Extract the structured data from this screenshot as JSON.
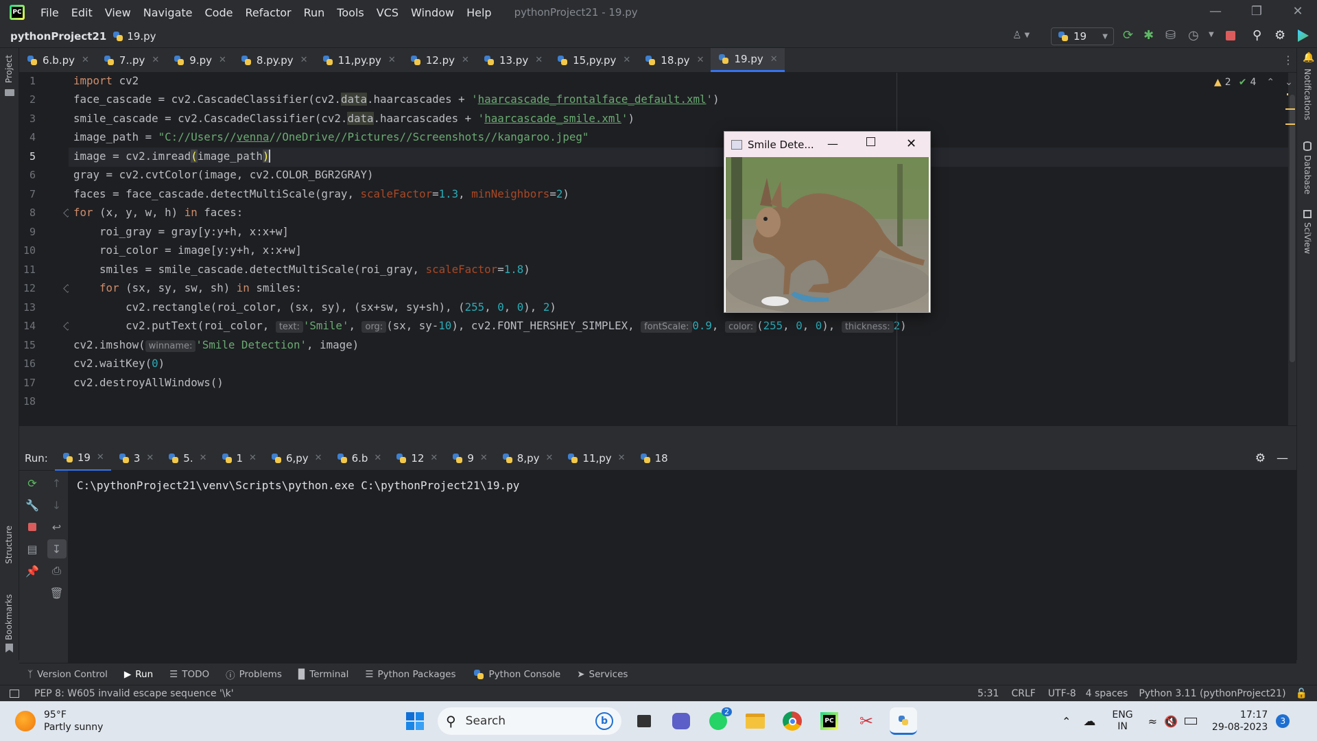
{
  "app": {
    "menu": [
      "File",
      "Edit",
      "View",
      "Navigate",
      "Code",
      "Refactor",
      "Run",
      "Tools",
      "VCS",
      "Window",
      "Help"
    ],
    "window_title": "pythonProject21 - 19.py"
  },
  "nav": {
    "project": "pythonProject21",
    "file": "19.py",
    "run_config": "19"
  },
  "tabs": [
    "6.b.py",
    "7..py",
    "9.py",
    "8.py.py",
    "11,py.py",
    "12.py",
    "13.py",
    "15,py.py",
    "18.py",
    "19.py"
  ],
  "active_tab": "19.py",
  "inspections": {
    "warnings": "2",
    "checks": "4"
  },
  "side_left": {
    "project": "Project",
    "structure": "Structure",
    "bookmarks": "Bookmarks"
  },
  "side_right": {
    "notifications": "Notifications",
    "database": "Database",
    "sciview": "SciView"
  },
  "code": {
    "lines": [
      "1",
      "2",
      "3",
      "4",
      "5",
      "6",
      "7",
      "8",
      "9",
      "10",
      "11",
      "12",
      "13",
      "14",
      "15",
      "16",
      "17",
      "18"
    ],
    "l1a": "import",
    "l1b": " cv2",
    "l2a": "face_cascade = cv2.CascadeClassifier(cv2.",
    "l2b": "data",
    "l2c": ".haarcascades + ",
    "l2d": "'",
    "l2e": "haarcascade_frontalface_default.xml",
    "l2f": "'",
    "l2g": ")",
    "l3a": "smile_cascade = cv2.CascadeClassifier(cv2.",
    "l3b": "data",
    "l3c": ".haarcascades + ",
    "l3d": "'",
    "l3e": "haarcascade_smile.xml",
    "l3f": "'",
    "l3g": ")",
    "l4a": "image_path = ",
    "l4b": "\"C://Users//",
    "l4c": "venna",
    "l4d": "//OneDrive//Pictures//Screenshots//kangaroo.jpeg\"",
    "l5a": "image = cv2.imread",
    "l5b": "(",
    "l5c": "image_path",
    "l5d": ")",
    "l6": "gray = cv2.cvtColor(image, cv2.COLOR_BGR2GRAY)",
    "l7a": "faces = face_cascade.detectMultiScale(gray, ",
    "l7b": "scaleFactor",
    "l7c": "=",
    "l7d": "1.3",
    "l7e": ", ",
    "l7f": "minNeighbors",
    "l7g": "=",
    "l7h": "2",
    "l7i": ")",
    "l8a": "for",
    "l8b": " (x, y, w, h) ",
    "l8c": "in",
    "l8d": " faces:",
    "l9": "    roi_gray = gray[y:y+h, x:x+w]",
    "l10": "    roi_color = image[y:y+h, x:x+w]",
    "l11a": "    smiles = smile_cascade.detectMultiScale(roi_gray, ",
    "l11b": "scaleFactor",
    "l11c": "=",
    "l11d": "1.8",
    "l11e": ")",
    "l12a": "    ",
    "l12b": "for",
    "l12c": " (sx, sy, sw, sh) ",
    "l12d": "in",
    "l12e": " smiles:",
    "l13a": "        cv2.rectangle(roi_color, (sx, sy), (sx+sw, sy+sh), (",
    "l13b": "255",
    "l13c": ", ",
    "l13d": "0",
    "l13e": ", ",
    "l13f": "0",
    "l13g": "), ",
    "l13h": "2",
    "l13i": ")",
    "l14a": "        cv2.putText(roi_color, ",
    "l14h1": "text:",
    "l14b": "'Smile'",
    "l14c": ", ",
    "l14h2": "org:",
    "l14d": "(sx, sy-",
    "l14e": "10",
    "l14f": "), cv2.FONT_HERSHEY_SIMPLEX, ",
    "l14h3": "fontScale:",
    "l14g": "0.9",
    "l14i": ", ",
    "l14h4": "color:",
    "l14j": "(",
    "l14k": "255",
    "l14l": ", ",
    "l14m": "0",
    "l14n": ", ",
    "l14o": "0",
    "l14p": "), ",
    "l14h5": "thickness:",
    "l14q": "2",
    "l14r": ")",
    "l15a": "cv2.imshow(",
    "l15h": "winname:",
    "l15b": "'Smile Detection'",
    "l15c": ", image)",
    "l16a": "cv2.waitKey(",
    "l16b": "0",
    "l16c": ")",
    "l17": "cv2.destroyAllWindows()"
  },
  "popup": {
    "title": "Smile Dete..."
  },
  "run": {
    "label": "Run:",
    "tabs": [
      "19",
      "3",
      "5.",
      "1",
      "6,py",
      "6.b",
      "12",
      "9",
      "8,py",
      "11,py",
      "18"
    ],
    "console": "C:\\pythonProject21\\venv\\Scripts\\python.exe C:\\pythonProject21\\19.py"
  },
  "bottom_tabs": [
    "Version Control",
    "Run",
    "TODO",
    "Problems",
    "Terminal",
    "Python Packages",
    "Python Console",
    "Services"
  ],
  "status": {
    "message": "PEP 8: W605 invalid escape sequence '\\k'",
    "position": "5:31",
    "line_sep": "CRLF",
    "encoding": "UTF-8",
    "indent": "4 spaces",
    "interpreter": "Python 3.11 (pythonProject21)"
  },
  "taskbar": {
    "temp": "95°F",
    "weather": "Partly sunny",
    "search": "Search",
    "lang1": "ENG",
    "lang2": "IN",
    "time": "17:17",
    "date": "29-08-2023",
    "notif": "3",
    "whatsapp_badge": "2"
  }
}
